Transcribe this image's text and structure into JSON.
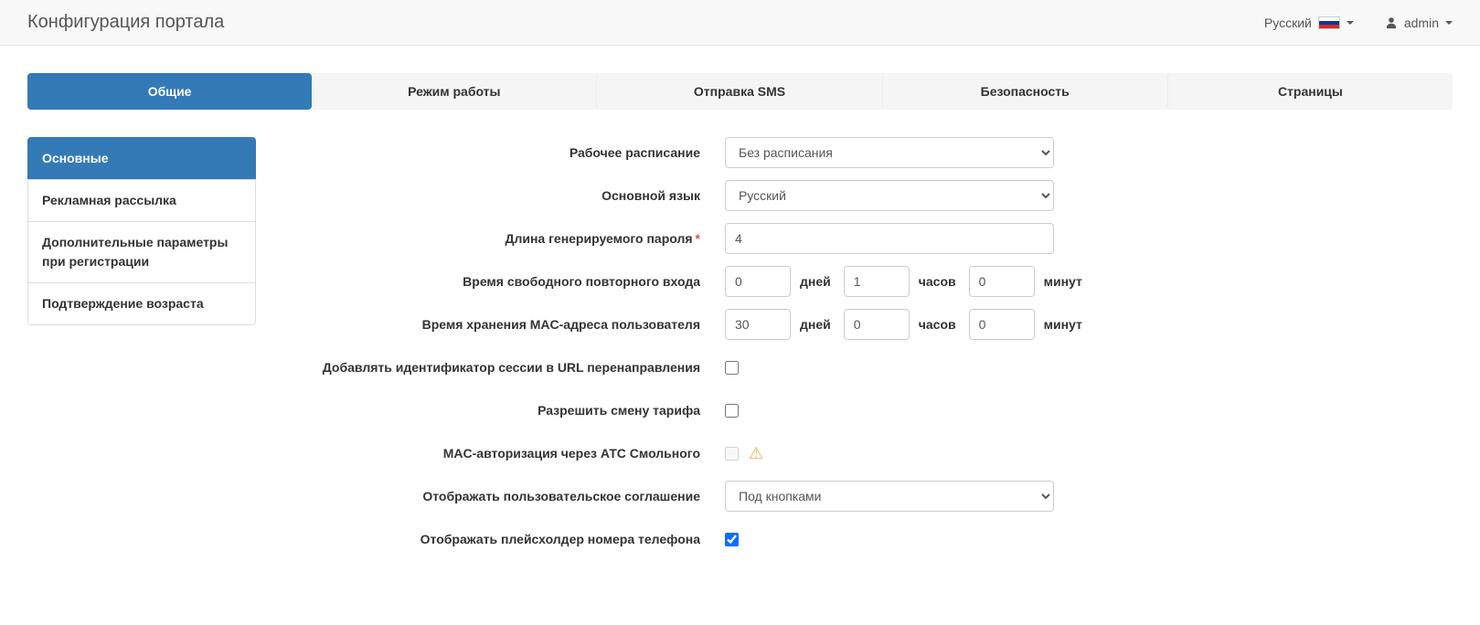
{
  "header": {
    "title": "Конфигурация портала",
    "language_label": "Русский",
    "user_label": "admin"
  },
  "tabs": [
    {
      "label": "Общие",
      "active": true
    },
    {
      "label": "Режим работы",
      "active": false
    },
    {
      "label": "Отправка SMS",
      "active": false
    },
    {
      "label": "Безопасность",
      "active": false
    },
    {
      "label": "Страницы",
      "active": false
    }
  ],
  "sidebar": {
    "items": [
      {
        "label": "Основные",
        "active": true
      },
      {
        "label": "Рекламная рассылка",
        "active": false
      },
      {
        "label": "Дополнительные параметры при регистрации",
        "active": false
      },
      {
        "label": "Подтверждение возраста",
        "active": false
      }
    ]
  },
  "form": {
    "units": {
      "days": "дней",
      "hours": "часов",
      "minutes": "минут"
    },
    "schedule": {
      "label": "Рабочее расписание",
      "value": "Без расписания"
    },
    "main_language": {
      "label": "Основной язык",
      "value": "Русский"
    },
    "password_length": {
      "label": "Длина генерируемого пароля",
      "required_mark": "*",
      "value": "4"
    },
    "free_reentry": {
      "label": "Время свободного повторного входа",
      "days": "0",
      "hours": "1",
      "minutes": "0"
    },
    "mac_storage": {
      "label": "Время хранения MAC-адреса пользователя",
      "days": "30",
      "hours": "0",
      "minutes": "0"
    },
    "session_url": {
      "label": "Добавлять идентификатор сессии в URL перенаправления",
      "checked": false
    },
    "tariff_change": {
      "label": "Разрешить смену тарифа",
      "checked": false
    },
    "mac_auth": {
      "label": "MAC-авторизация через АТС Смольного",
      "checked": false,
      "disabled": true
    },
    "user_agreement": {
      "label": "Отображать пользовательское соглашение",
      "value": "Под кнопками"
    },
    "phone_placeholder": {
      "label": "Отображать плейсхолдер номера телефона",
      "checked": true
    }
  },
  "icons": {
    "warning": "⚠"
  },
  "colors": {
    "accent": "#337ab7",
    "warning": "#f0ad4e",
    "required": "#d9534f"
  }
}
